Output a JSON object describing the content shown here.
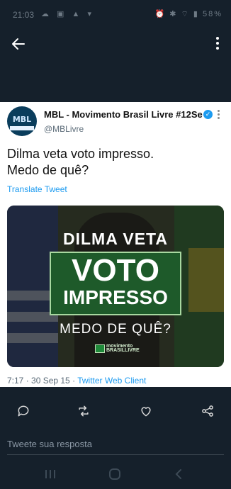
{
  "status_bar": {
    "time": "21:03",
    "battery": "58%"
  },
  "tweet": {
    "author_name": "MBL - Movimento Brasil Livre #12Se...",
    "handle": "@MBLivre",
    "avatar_text": "MBL",
    "text": "Dilma veta voto impresso.\nMedo de quê?",
    "translate_label": "Translate Tweet",
    "image": {
      "line1": "DILMA VETA",
      "line2": "VOTO",
      "line3": "IMPRESSO",
      "line4": "MEDO DE QUÊ?",
      "logo_text_top": "movimento",
      "logo_text_bottom": "BRASILLIVRE"
    },
    "time": "7:17 · 30 Sep 15 · ",
    "client": "Twitter Web Client"
  },
  "reply": {
    "placeholder": "Tweete sua resposta"
  },
  "colors": {
    "accent": "#1d9bf0",
    "background": "#15202b",
    "card": "#ffffff"
  },
  "icons": [
    "back-arrow-icon",
    "more-vertical-icon",
    "verified-icon",
    "reply-icon",
    "retweet-icon",
    "like-icon",
    "share-icon",
    "recents-icon",
    "home-icon",
    "back-nav-icon"
  ]
}
